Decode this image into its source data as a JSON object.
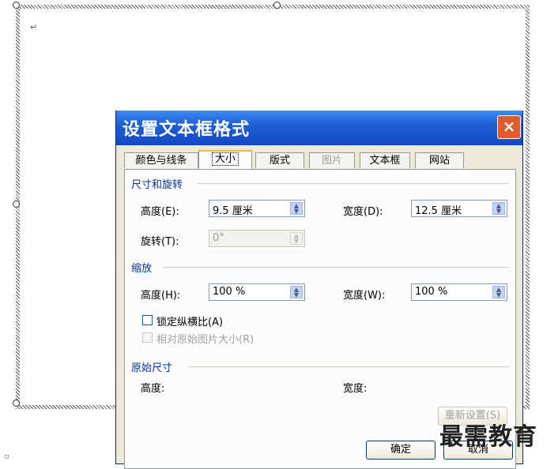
{
  "document": {
    "paragraph_mark": "↵",
    "corner_mark": "⌑"
  },
  "dialog": {
    "title": "设置文本框格式",
    "close_icon": "×",
    "tabs": [
      {
        "label": "颜色与线条",
        "active": false,
        "disabled": false
      },
      {
        "label": "大小",
        "active": true,
        "disabled": false
      },
      {
        "label": "版式",
        "active": false,
        "disabled": false
      },
      {
        "label": "图片",
        "active": false,
        "disabled": true
      },
      {
        "label": "文本框",
        "active": false,
        "disabled": false
      },
      {
        "label": "网站",
        "active": false,
        "disabled": false
      }
    ],
    "size_rotate": {
      "header": "尺寸和旋转",
      "height_label": "高度(E):",
      "height_value": "9.5 厘米",
      "width_label": "宽度(D):",
      "width_value": "12.5 厘米",
      "rotate_label": "旋转(T):",
      "rotate_value": "0°"
    },
    "scale": {
      "header": "缩放",
      "height_label": "高度(H):",
      "height_value": "100 %",
      "width_label": "宽度(W):",
      "width_value": "100 %",
      "lock_ratio_label": "锁定纵横比(A)",
      "relative_label": "相对原始图片大小(R)"
    },
    "original": {
      "header": "原始尺寸",
      "height_label": "高度:",
      "width_label": "宽度:",
      "reset_label": "重新设置(S)"
    },
    "ok_label": "确定",
    "cancel_label": "取消"
  },
  "watermark": "最需教育",
  "colors": {
    "title_bar": "#1f5fd8",
    "section_header": "#003399",
    "close_button": "#e35a2d"
  }
}
